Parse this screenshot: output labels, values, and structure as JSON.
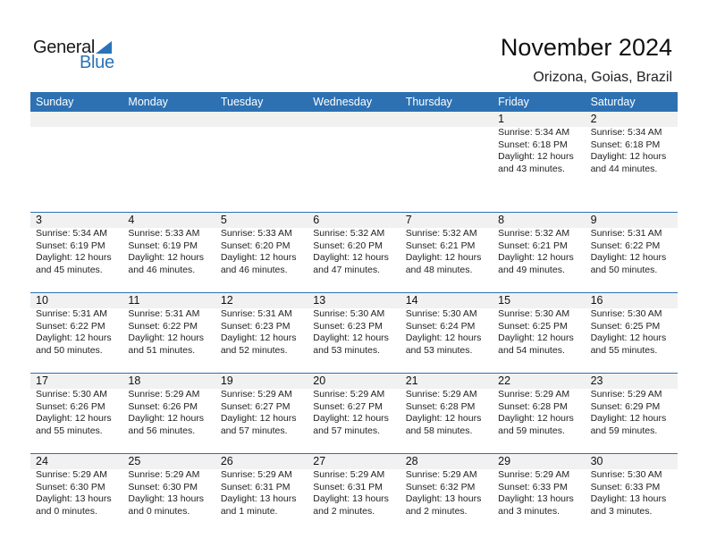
{
  "logo": {
    "word1": "General",
    "word2": "Blue",
    "icon": "triangle-flag-icon",
    "brand_color": "#2a73b8"
  },
  "header": {
    "title": "November 2024",
    "location": "Orizona, Goias, Brazil"
  },
  "colors": {
    "header_bg": "#2d71b3",
    "date_strip_bg": "#f1f1f1"
  },
  "weekdays": [
    "Sunday",
    "Monday",
    "Tuesday",
    "Wednesday",
    "Thursday",
    "Friday",
    "Saturday"
  ],
  "weeks": [
    [
      null,
      null,
      null,
      null,
      null,
      {
        "day": "1",
        "sunrise": "Sunrise: 5:34 AM",
        "sunset": "Sunset: 6:18 PM",
        "daylight1": "Daylight: 12 hours",
        "daylight2": "and 43 minutes."
      },
      {
        "day": "2",
        "sunrise": "Sunrise: 5:34 AM",
        "sunset": "Sunset: 6:18 PM",
        "daylight1": "Daylight: 12 hours",
        "daylight2": "and 44 minutes."
      }
    ],
    [
      {
        "day": "3",
        "sunrise": "Sunrise: 5:34 AM",
        "sunset": "Sunset: 6:19 PM",
        "daylight1": "Daylight: 12 hours",
        "daylight2": "and 45 minutes."
      },
      {
        "day": "4",
        "sunrise": "Sunrise: 5:33 AM",
        "sunset": "Sunset: 6:19 PM",
        "daylight1": "Daylight: 12 hours",
        "daylight2": "and 46 minutes."
      },
      {
        "day": "5",
        "sunrise": "Sunrise: 5:33 AM",
        "sunset": "Sunset: 6:20 PM",
        "daylight1": "Daylight: 12 hours",
        "daylight2": "and 46 minutes."
      },
      {
        "day": "6",
        "sunrise": "Sunrise: 5:32 AM",
        "sunset": "Sunset: 6:20 PM",
        "daylight1": "Daylight: 12 hours",
        "daylight2": "and 47 minutes."
      },
      {
        "day": "7",
        "sunrise": "Sunrise: 5:32 AM",
        "sunset": "Sunset: 6:21 PM",
        "daylight1": "Daylight: 12 hours",
        "daylight2": "and 48 minutes."
      },
      {
        "day": "8",
        "sunrise": "Sunrise: 5:32 AM",
        "sunset": "Sunset: 6:21 PM",
        "daylight1": "Daylight: 12 hours",
        "daylight2": "and 49 minutes."
      },
      {
        "day": "9",
        "sunrise": "Sunrise: 5:31 AM",
        "sunset": "Sunset: 6:22 PM",
        "daylight1": "Daylight: 12 hours",
        "daylight2": "and 50 minutes."
      }
    ],
    [
      {
        "day": "10",
        "sunrise": "Sunrise: 5:31 AM",
        "sunset": "Sunset: 6:22 PM",
        "daylight1": "Daylight: 12 hours",
        "daylight2": "and 50 minutes."
      },
      {
        "day": "11",
        "sunrise": "Sunrise: 5:31 AM",
        "sunset": "Sunset: 6:22 PM",
        "daylight1": "Daylight: 12 hours",
        "daylight2": "and 51 minutes."
      },
      {
        "day": "12",
        "sunrise": "Sunrise: 5:31 AM",
        "sunset": "Sunset: 6:23 PM",
        "daylight1": "Daylight: 12 hours",
        "daylight2": "and 52 minutes."
      },
      {
        "day": "13",
        "sunrise": "Sunrise: 5:30 AM",
        "sunset": "Sunset: 6:23 PM",
        "daylight1": "Daylight: 12 hours",
        "daylight2": "and 53 minutes."
      },
      {
        "day": "14",
        "sunrise": "Sunrise: 5:30 AM",
        "sunset": "Sunset: 6:24 PM",
        "daylight1": "Daylight: 12 hours",
        "daylight2": "and 53 minutes."
      },
      {
        "day": "15",
        "sunrise": "Sunrise: 5:30 AM",
        "sunset": "Sunset: 6:25 PM",
        "daylight1": "Daylight: 12 hours",
        "daylight2": "and 54 minutes."
      },
      {
        "day": "16",
        "sunrise": "Sunrise: 5:30 AM",
        "sunset": "Sunset: 6:25 PM",
        "daylight1": "Daylight: 12 hours",
        "daylight2": "and 55 minutes."
      }
    ],
    [
      {
        "day": "17",
        "sunrise": "Sunrise: 5:30 AM",
        "sunset": "Sunset: 6:26 PM",
        "daylight1": "Daylight: 12 hours",
        "daylight2": "and 55 minutes."
      },
      {
        "day": "18",
        "sunrise": "Sunrise: 5:29 AM",
        "sunset": "Sunset: 6:26 PM",
        "daylight1": "Daylight: 12 hours",
        "daylight2": "and 56 minutes."
      },
      {
        "day": "19",
        "sunrise": "Sunrise: 5:29 AM",
        "sunset": "Sunset: 6:27 PM",
        "daylight1": "Daylight: 12 hours",
        "daylight2": "and 57 minutes."
      },
      {
        "day": "20",
        "sunrise": "Sunrise: 5:29 AM",
        "sunset": "Sunset: 6:27 PM",
        "daylight1": "Daylight: 12 hours",
        "daylight2": "and 57 minutes."
      },
      {
        "day": "21",
        "sunrise": "Sunrise: 5:29 AM",
        "sunset": "Sunset: 6:28 PM",
        "daylight1": "Daylight: 12 hours",
        "daylight2": "and 58 minutes."
      },
      {
        "day": "22",
        "sunrise": "Sunrise: 5:29 AM",
        "sunset": "Sunset: 6:28 PM",
        "daylight1": "Daylight: 12 hours",
        "daylight2": "and 59 minutes."
      },
      {
        "day": "23",
        "sunrise": "Sunrise: 5:29 AM",
        "sunset": "Sunset: 6:29 PM",
        "daylight1": "Daylight: 12 hours",
        "daylight2": "and 59 minutes."
      }
    ],
    [
      {
        "day": "24",
        "sunrise": "Sunrise: 5:29 AM",
        "sunset": "Sunset: 6:30 PM",
        "daylight1": "Daylight: 13 hours",
        "daylight2": "and 0 minutes."
      },
      {
        "day": "25",
        "sunrise": "Sunrise: 5:29 AM",
        "sunset": "Sunset: 6:30 PM",
        "daylight1": "Daylight: 13 hours",
        "daylight2": "and 0 minutes."
      },
      {
        "day": "26",
        "sunrise": "Sunrise: 5:29 AM",
        "sunset": "Sunset: 6:31 PM",
        "daylight1": "Daylight: 13 hours",
        "daylight2": "and 1 minute."
      },
      {
        "day": "27",
        "sunrise": "Sunrise: 5:29 AM",
        "sunset": "Sunset: 6:31 PM",
        "daylight1": "Daylight: 13 hours",
        "daylight2": "and 2 minutes."
      },
      {
        "day": "28",
        "sunrise": "Sunrise: 5:29 AM",
        "sunset": "Sunset: 6:32 PM",
        "daylight1": "Daylight: 13 hours",
        "daylight2": "and 2 minutes."
      },
      {
        "day": "29",
        "sunrise": "Sunrise: 5:29 AM",
        "sunset": "Sunset: 6:33 PM",
        "daylight1": "Daylight: 13 hours",
        "daylight2": "and 3 minutes."
      },
      {
        "day": "30",
        "sunrise": "Sunrise: 5:30 AM",
        "sunset": "Sunset: 6:33 PM",
        "daylight1": "Daylight: 13 hours",
        "daylight2": "and 3 minutes."
      }
    ]
  ]
}
